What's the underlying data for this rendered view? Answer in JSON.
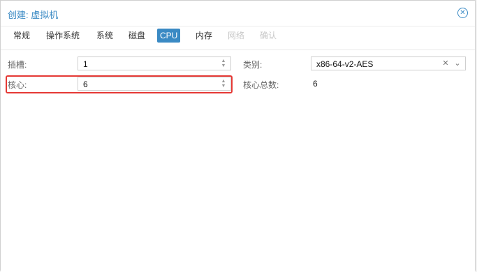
{
  "dialog": {
    "title": "创建: 虚拟机",
    "tabs": [
      {
        "label": "常规",
        "state": "normal"
      },
      {
        "label": "操作系统",
        "state": "normal"
      },
      {
        "label": "系统",
        "state": "normal"
      },
      {
        "label": "磁盘",
        "state": "normal"
      },
      {
        "label": "CPU",
        "state": "active"
      },
      {
        "label": "内存",
        "state": "normal"
      },
      {
        "label": "网络",
        "state": "disabled"
      },
      {
        "label": "确认",
        "state": "disabled"
      }
    ],
    "colors": {
      "accent": "#3a8ac4",
      "highlight": "#e53935"
    }
  },
  "cpu": {
    "sockets_label": "插槽:",
    "sockets_value": "1",
    "cores_label": "核心:",
    "cores_value": "6",
    "type_label": "类别:",
    "type_value": "x86-64-v2-AES",
    "total_cores_label": "核心总数:",
    "total_cores_value": "6"
  },
  "icons": {
    "close": "close-circle-icon",
    "spinner": "spinner-arrows-icon",
    "clear": "clear-x-icon",
    "dropdown": "chevron-down-icon"
  }
}
